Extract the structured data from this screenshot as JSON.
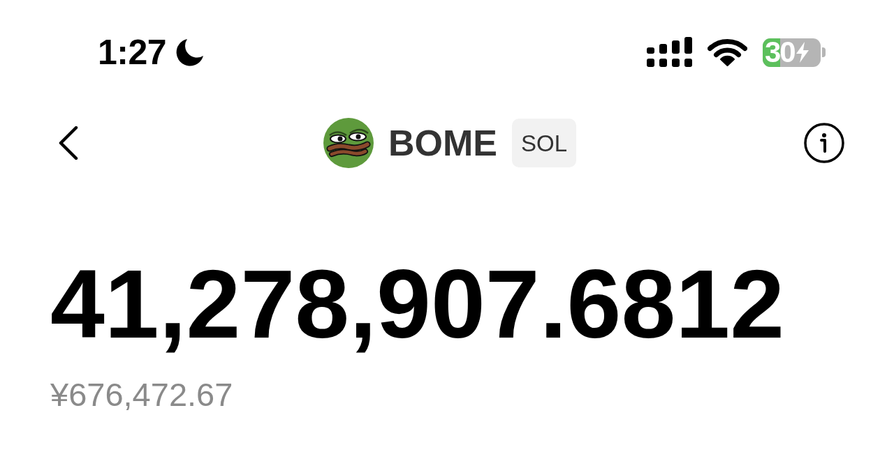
{
  "status_bar": {
    "time": "1:27",
    "do_not_disturb": true,
    "battery": {
      "percent": "30",
      "level": 0.3,
      "charging": true
    }
  },
  "header": {
    "token": {
      "symbol": "BOME",
      "network": "SOL"
    }
  },
  "balance": {
    "amount": "41,278,907.6812",
    "fiat_value": "¥676,472.67"
  }
}
